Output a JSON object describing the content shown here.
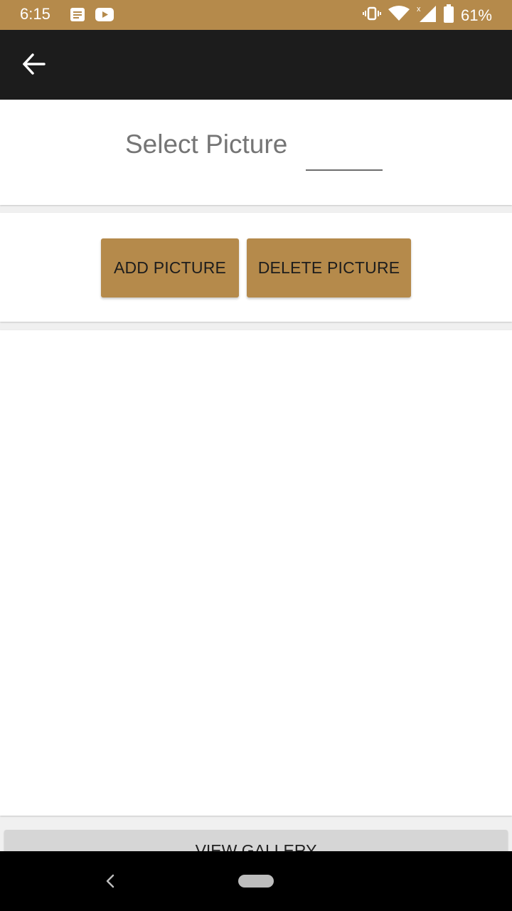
{
  "status_bar": {
    "time": "6:15",
    "battery_percent": "61%",
    "left_icons": [
      "notification-icon",
      "youtube-icon"
    ],
    "right_icons": [
      "vibrate-icon",
      "wifi-icon",
      "signal-icon",
      "battery-icon"
    ],
    "background_color": "#b58a4b"
  },
  "toolbar": {
    "back_icon": "arrow-back-icon",
    "background_color": "#1c1c1c"
  },
  "select_section": {
    "label": "Select Picture",
    "dropdown_value": ""
  },
  "actions": {
    "add_label": "ADD PICTURE",
    "delete_label": "DELETE PICTURE",
    "accent_color": "#b58a4b"
  },
  "gallery": {
    "view_label": "VIEW GALLERY"
  },
  "nav_bar": {
    "back_icon": "nav-back-icon",
    "home_icon": "nav-home-pill"
  }
}
